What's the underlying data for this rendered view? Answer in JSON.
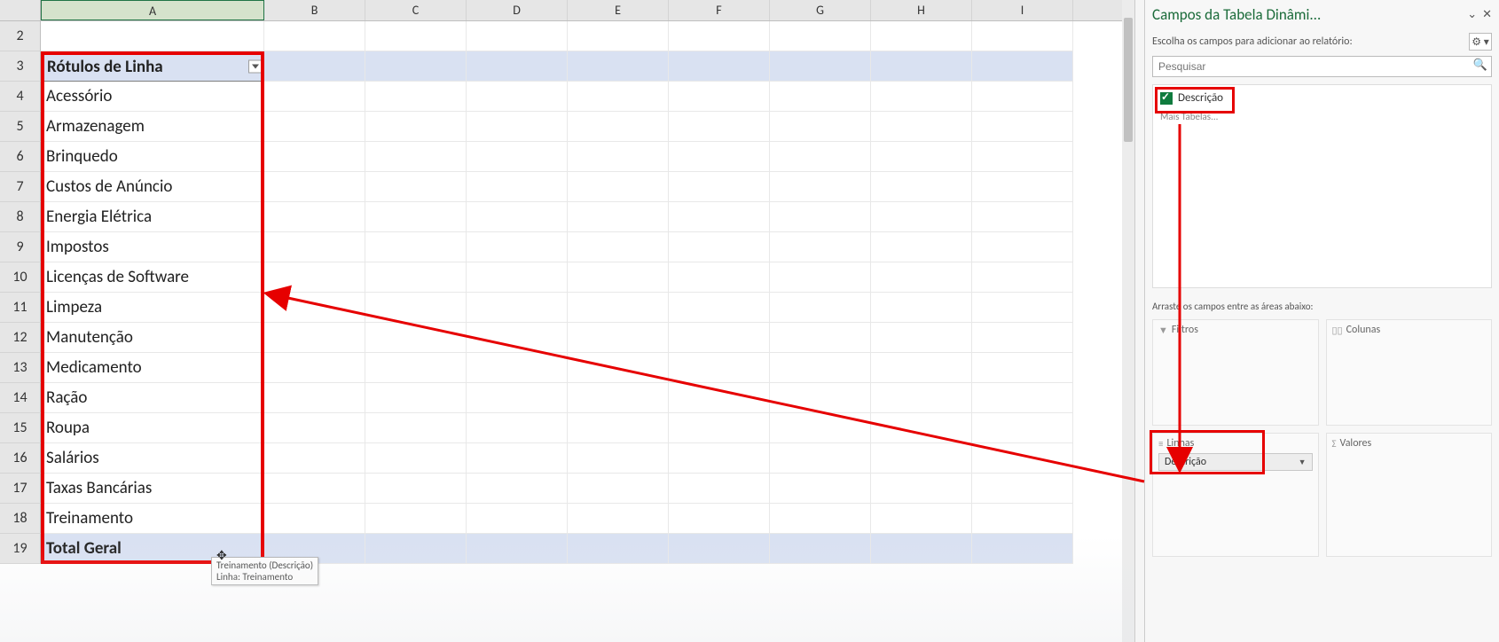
{
  "spreadsheet": {
    "col_headers": [
      "A",
      "B",
      "C",
      "D",
      "E",
      "F",
      "G",
      "H",
      "I"
    ],
    "rows": [
      {
        "num": "2",
        "A": ""
      },
      {
        "num": "3",
        "A": "Rótulos de Linha",
        "is_header": true
      },
      {
        "num": "4",
        "A": "Acessório"
      },
      {
        "num": "5",
        "A": "Armazenagem"
      },
      {
        "num": "6",
        "A": "Brinquedo"
      },
      {
        "num": "7",
        "A": "Custos de Anúncio"
      },
      {
        "num": "8",
        "A": "Energia Elétrica"
      },
      {
        "num": "9",
        "A": "Impostos"
      },
      {
        "num": "10",
        "A": "Licenças de Software"
      },
      {
        "num": "11",
        "A": "Limpeza"
      },
      {
        "num": "12",
        "A": "Manutenção"
      },
      {
        "num": "13",
        "A": "Medicamento"
      },
      {
        "num": "14",
        "A": "Ração"
      },
      {
        "num": "15",
        "A": "Roupa"
      },
      {
        "num": "16",
        "A": "Salários"
      },
      {
        "num": "17",
        "A": "Taxas Bancárias"
      },
      {
        "num": "18",
        "A": "Treinamento"
      },
      {
        "num": "19",
        "A": "Total Geral",
        "is_total": true
      }
    ],
    "tooltip_line1": "Treinamento (Descrição)",
    "tooltip_line2": "Linha: Treinamento"
  },
  "taskpane": {
    "title": "Campos da Tabela Dinâmi...",
    "subtitle": "Escolha os campos para adicionar ao relatório:",
    "search_placeholder": "Pesquisar",
    "field_descricao": "Descrição",
    "more_tables": "Mais Tabelas...",
    "drag_hint": "Arraste os campos entre as áreas abaixo:",
    "filtros_label": "Filtros",
    "colunas_label": "Colunas",
    "linhas_label": "Linhas",
    "valores_label": "Valores",
    "linhas_item": "Descrição"
  }
}
